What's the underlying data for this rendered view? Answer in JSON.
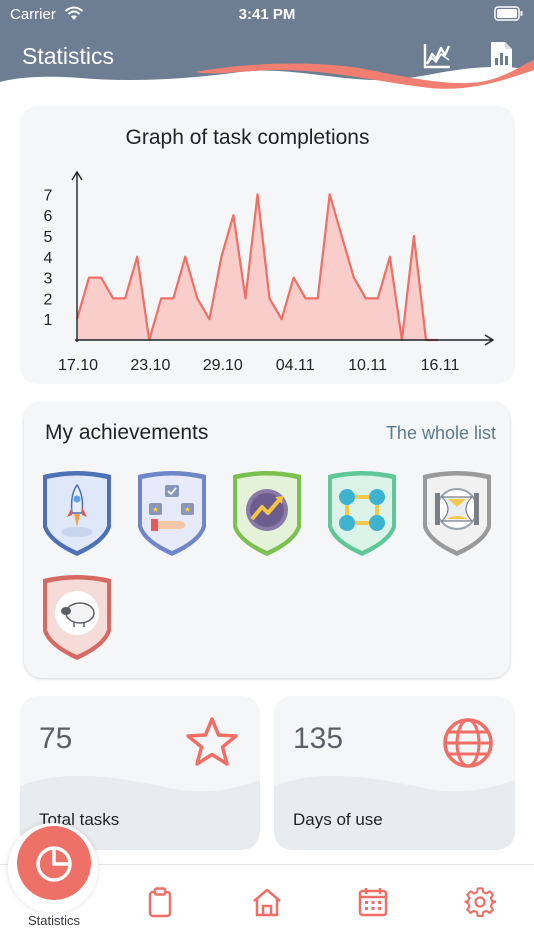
{
  "status": {
    "carrier": "Carrier",
    "time": "3:41 PM"
  },
  "header": {
    "title": "Statistics",
    "icons": [
      "line-chart-icon",
      "report-icon"
    ]
  },
  "graph": {
    "title": "Graph of task completions",
    "chart_data": {
      "type": "area",
      "title": "Graph of task completions",
      "x_tick_labels": [
        "17.10",
        "23.10",
        "29.10",
        "04.11",
        "10.11",
        "16.11"
      ],
      "y_tick_labels": [
        "1",
        "2",
        "3",
        "4",
        "5",
        "6",
        "7"
      ],
      "ylim": [
        0,
        7
      ],
      "series": [
        {
          "values": [
            1,
            3,
            3,
            2,
            2,
            4,
            0,
            2,
            2,
            4,
            2,
            1,
            4,
            6,
            2,
            7,
            2,
            1,
            3,
            2,
            2,
            7,
            5,
            3,
            2,
            2,
            4,
            0,
            5,
            0,
            0
          ]
        }
      ],
      "color": "#ef6f66",
      "fill": "#f9cdca"
    }
  },
  "achievements": {
    "title": "My achievements",
    "link": "The whole list",
    "badges": [
      {
        "name": "rocket-badge",
        "color": "#4c72b5"
      },
      {
        "name": "choice-badge",
        "color": "#6f86c9"
      },
      {
        "name": "growth-badge",
        "color": "#7cc14f"
      },
      {
        "name": "exchange-badge",
        "color": "#5fc79a"
      },
      {
        "name": "hourglass-badge",
        "color": "#9a9a9a"
      },
      {
        "name": "sheep-badge",
        "color": "#d66a62"
      }
    ]
  },
  "stats": {
    "total_tasks": {
      "value": "75",
      "label": "Total tasks",
      "icon": "star-icon"
    },
    "days_of_use": {
      "value": "135",
      "label": "Days of use",
      "icon": "globe-icon"
    }
  },
  "tabbar": {
    "active_label": "Statistics",
    "items": [
      "statistics",
      "clipboard",
      "home",
      "calendar",
      "settings"
    ]
  }
}
